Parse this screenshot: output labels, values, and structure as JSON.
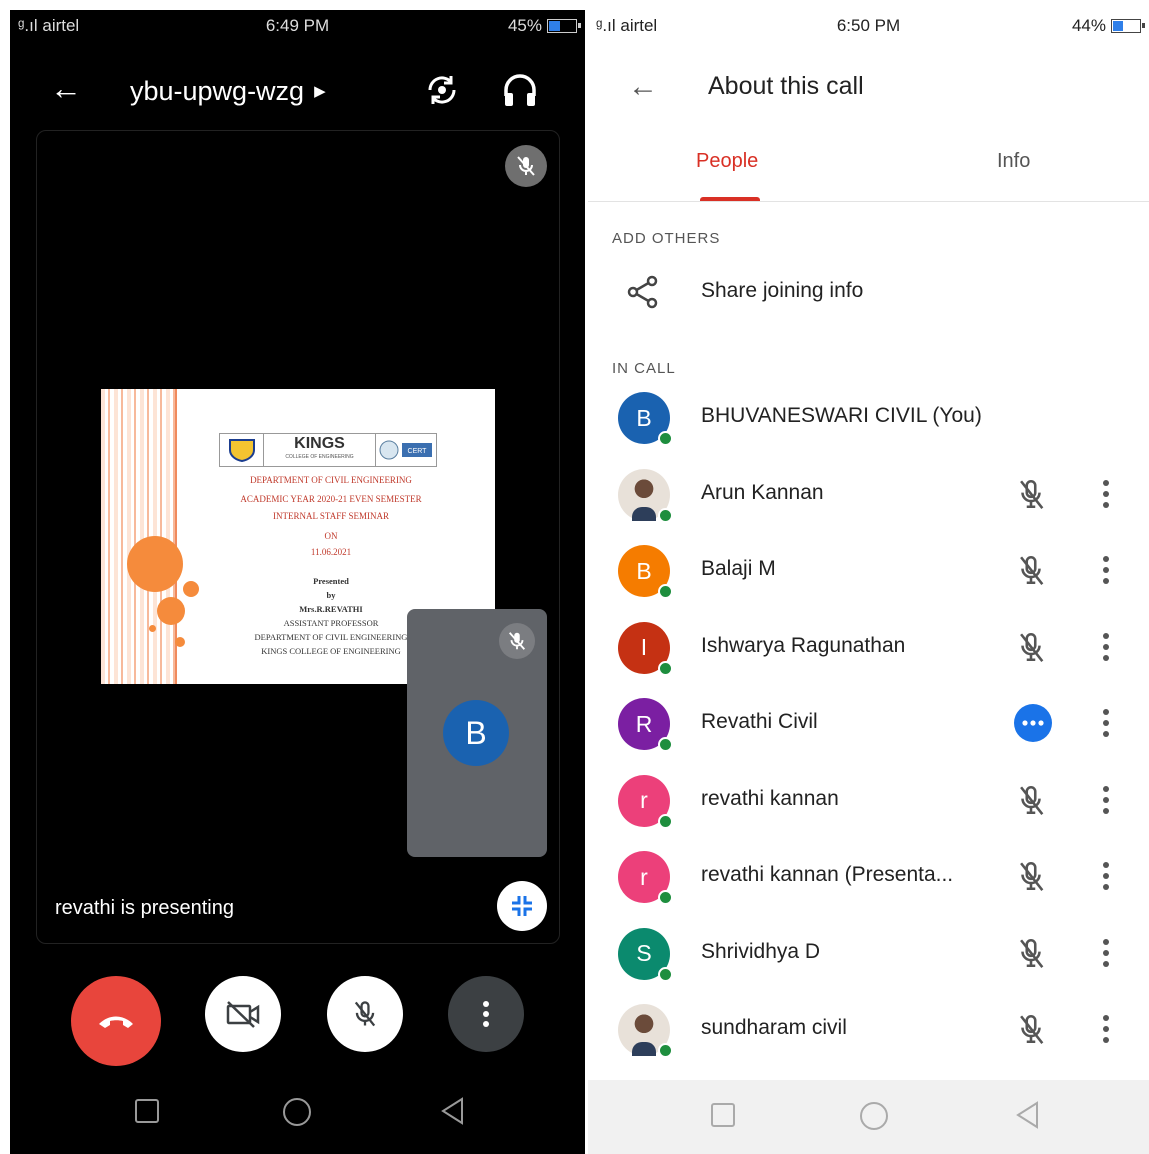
{
  "left_phone": {
    "status": {
      "carrier": "airtel",
      "time": "6:49 PM",
      "battery": "45%",
      "battery_level": 0.45
    },
    "meeting_code": "ybu-upwg-wzg",
    "slide": {
      "logo_text": "KINGS",
      "logo_sub": "COLLEGE OF ENGINEERING",
      "cert_text": "CERT",
      "lines_red": [
        "DEPARTMENT OF CIVIL ENGINEERING",
        "ACADEMIC YEAR 2020-21 EVEN SEMESTER",
        "INTERNAL STAFF SEMINAR",
        "ON",
        "11.06.2021"
      ],
      "lines_black": [
        "Presented",
        "by",
        "Mrs.R.REVATHI",
        "ASSISTANT PROFESSOR",
        "DEPARTMENT OF CIVIL ENGINEERING",
        "KINGS COLLEGE OF ENGINEERING"
      ]
    },
    "self_avatar_letter": "B",
    "presenting_label": "revathi is presenting"
  },
  "right_phone": {
    "status": {
      "carrier": "airtel",
      "time": "6:50 PM",
      "battery": "44%",
      "battery_level": 0.44
    },
    "title": "About this call",
    "tabs": {
      "people": "People",
      "info": "Info"
    },
    "add_others": "ADD OTHERS",
    "share_label": "Share joining info",
    "in_call": "IN CALL",
    "participants": [
      {
        "name": "BHUVANESWARI CIVIL (You)",
        "letter": "B",
        "color": "#1a62b0",
        "photo": false,
        "muted": false,
        "self": true
      },
      {
        "name": "Arun Kannan",
        "letter": "",
        "color": "#cccccc",
        "photo": true,
        "muted": true
      },
      {
        "name": "Balaji M",
        "letter": "B",
        "color": "#f57c00",
        "photo": false,
        "muted": true
      },
      {
        "name": "Ishwarya Ragunathan",
        "letter": "I",
        "color": "#c53113",
        "photo": false,
        "muted": true
      },
      {
        "name": "Revathi Civil",
        "letter": "R",
        "color": "#7b1fa2",
        "photo": false,
        "muted": false,
        "speaking": true
      },
      {
        "name": "revathi kannan",
        "letter": "r",
        "color": "#ec407a",
        "photo": false,
        "muted": true
      },
      {
        "name": "revathi kannan (Presenta...",
        "letter": "r",
        "color": "#ec407a",
        "photo": false,
        "muted": true
      },
      {
        "name": "Shrividhya D",
        "letter": "S",
        "color": "#0b8a6e",
        "photo": false,
        "muted": true
      },
      {
        "name": "sundharam civil",
        "letter": "",
        "color": "#cccccc",
        "photo": true,
        "muted": true
      }
    ]
  }
}
